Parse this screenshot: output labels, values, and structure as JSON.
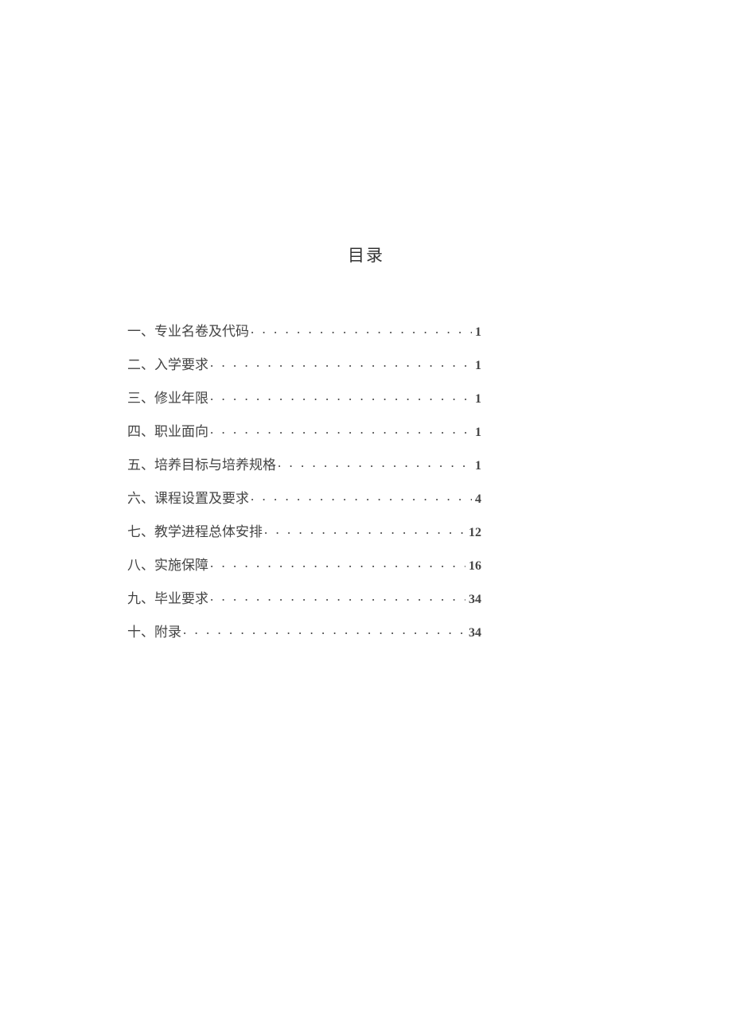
{
  "title": "目录",
  "entries": [
    {
      "label": "一、专业名卷及代码",
      "page": "1"
    },
    {
      "label": "二、入学要求",
      "page": "1"
    },
    {
      "label": "三、修业年限",
      "page": "1"
    },
    {
      "label": "四、职业面向",
      "page": "1"
    },
    {
      "label": "五、培养目标与培养规格",
      "page": "1"
    },
    {
      "label": "六、课程设置及要求",
      "page": "4"
    },
    {
      "label": "七、教学进程总体安排",
      "page": "12"
    },
    {
      "label": "八、实施保障",
      "page": "16"
    },
    {
      "label": "九、毕业要求",
      "page": "34"
    },
    {
      "label": "十、附录",
      "page": "34"
    }
  ]
}
